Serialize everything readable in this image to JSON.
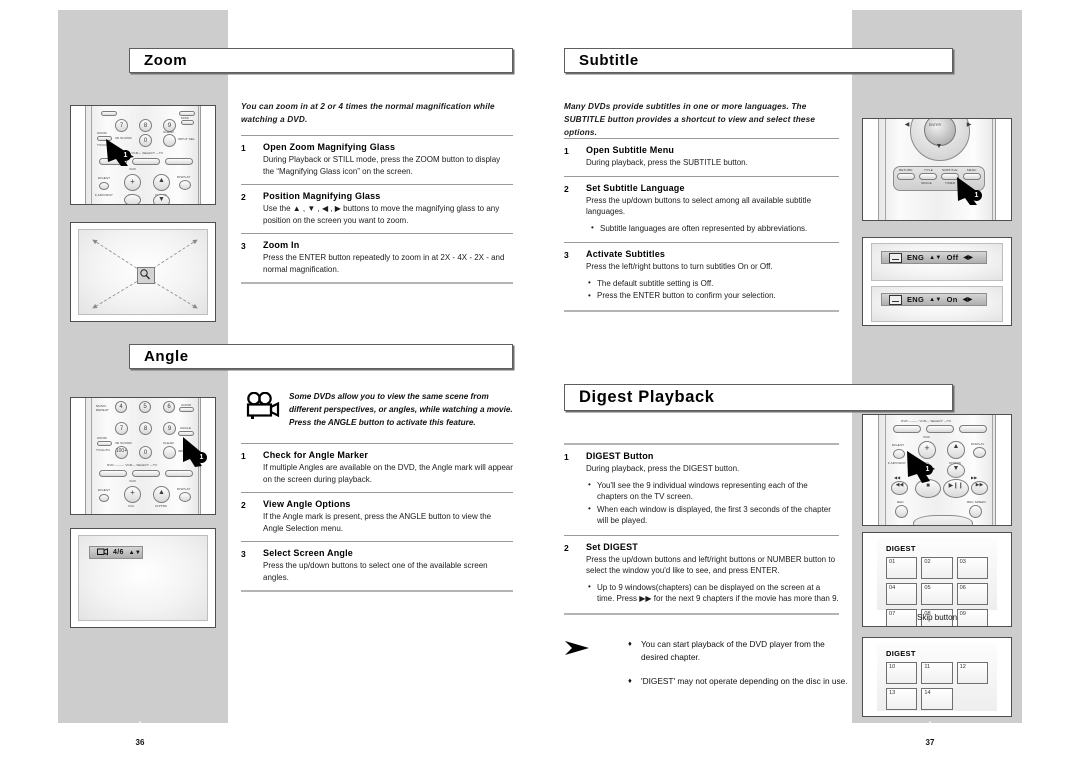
{
  "document": {
    "type": "dvd-player-user-manual-spread"
  },
  "left_page": {
    "page_number": "36",
    "sections": [
      {
        "id": "zoom",
        "heading": "Zoom",
        "intro": "You can zoom in at 2 or 4 times the normal magnification while watching a DVD.",
        "steps": [
          {
            "num": "1",
            "title": "Open Zoom Magnifying Glass",
            "desc": "During Playback or STILL mode, press the ZOOM button to display the “Magnifying Glass icon” on the screen.",
            "bullets": []
          },
          {
            "num": "2",
            "title": "Position Magnifying Glass",
            "desc": "Use the ▲ , ▼ , ◀ , ▶ buttons to move the magnifying glass to any position on the screen you want to zoom.",
            "bullets": []
          },
          {
            "num": "3",
            "title": "Zoom In",
            "desc": "Press the ENTER button repeatedly to zoom in at 2X - 4X - 2X - and normal magnification.",
            "bullets": []
          }
        ],
        "illustrations": {
          "remote_callout": "1",
          "remote_highlighted_button": "ZOOM",
          "screen_content": "magnifying-glass-with-four-diagonal-arrows"
        }
      },
      {
        "id": "angle",
        "heading": "Angle",
        "camera_note": "Some DVDs allow you to view the same scene from different perspectives, or angles, while watching a movie. Press the ANGLE button to activate this feature.",
        "steps": [
          {
            "num": "1",
            "title": "Check for Angle Marker",
            "desc": "If multiple Angles are available on the DVD, the Angle mark will appear on the screen during playback.",
            "bullets": []
          },
          {
            "num": "2",
            "title": "View Angle Options",
            "desc": "If the Angle mark is present, press the ANGLE button to view the Angle Selection menu.",
            "bullets": []
          },
          {
            "num": "3",
            "title": "Select Screen Angle",
            "desc": "Press the up/down buttons to select one of the available screen angles.",
            "bullets": []
          }
        ],
        "illustrations": {
          "remote_callout": "1",
          "remote_highlighted_button": "ANGLE",
          "osd_text": "4/6"
        }
      }
    ]
  },
  "right_page": {
    "page_number": "37",
    "sections": [
      {
        "id": "subtitle",
        "heading": "Subtitle",
        "intro": "Many DVDs provide subtitles in one or more languages. The SUBTITLE button provides a shortcut to view and select these options.",
        "steps": [
          {
            "num": "1",
            "title": "Open Subtitle Menu",
            "desc": "During playback, press the SUBTITLE button.",
            "bullets": []
          },
          {
            "num": "2",
            "title": "Set Subtitle Language",
            "desc": "Press the up/down buttons to select among all available subtitle languages.",
            "bullets": [
              "Subtitle languages are often represented by abbreviations."
            ]
          },
          {
            "num": "3",
            "title": "Activate Subtitles",
            "desc": "Press the left/right buttons to turn subtitles On or Off.",
            "bullets": [
              "The default subtitle setting is Off.",
              "Press the ENTER button to confirm your selection."
            ]
          }
        ],
        "illustrations": {
          "remote_callout": "1",
          "remote_highlighted_button": "SUBTITLE",
          "osd_bars": [
            {
              "lang": "ENG",
              "state": "Off"
            },
            {
              "lang": "ENG",
              "state": "On"
            }
          ]
        }
      },
      {
        "id": "digest-playback",
        "heading": "Digest Playback",
        "steps": [
          {
            "num": "1",
            "title": "DIGEST Button",
            "desc": "During playback, press the DIGEST button.",
            "bullets": [
              "You'll see the 9 individual windows representing each of the chapters on the TV screen.",
              "When each window is displayed, the first 3 seconds of the chapter will be played."
            ]
          },
          {
            "num": "2",
            "title": "Set DIGEST",
            "desc": "Press the up/down buttons and left/right buttons or NUMBER button to select the window you'd like to see, and press ENTER.",
            "bullets": [
              "Up to 9 windows(chapters) can be displayed on the screen at a time. Press ▶▶ for the next 9 chapters if the movie has more than 9."
            ]
          }
        ],
        "notes": [
          "You can start playback of the DVD player from the desired chapter.",
          "'DIGEST' may not operate depending on the disc in use."
        ],
        "illustrations": {
          "remote_callout": "1",
          "remote_highlighted_button": "DIGEST",
          "digest_screen_1": {
            "title": "DIGEST",
            "cells": [
              "01",
              "02",
              "03",
              "04",
              "05",
              "06",
              "07",
              "08",
              "09"
            ],
            "caption": "Skip button"
          },
          "digest_screen_2": {
            "title": "DIGEST",
            "cells": [
              "10",
              "11",
              "12",
              "13",
              "14"
            ]
          }
        }
      }
    ]
  },
  "remote_labels": {
    "zoom_remote": {
      "keys": [
        "7",
        "8",
        "9",
        "0"
      ],
      "small": [
        "ZOOM",
        "TV/VCR",
        "3D SOUND",
        "CLEAR",
        "MISC",
        "INPUT SEL.",
        "DVD",
        "VCR",
        "SELECT",
        "TV",
        "DIGEST",
        "F.ADV/SKIP",
        "VOL",
        "CH/TRK",
        "DISPLAY"
      ]
    },
    "angle_remote": {
      "keys": [
        "7",
        "8",
        "9",
        "0",
        "100+"
      ],
      "small": [
        "MUSIC REPEAT",
        "ANGLE",
        "CLEAR",
        "AUDIO",
        "ZOOM",
        "TV/AUTO",
        "3D SOUND",
        "INPUT SEL.",
        "DVD",
        "VCR",
        "SELECT",
        "TV",
        "DIGEST",
        "VOL",
        "CH/TRK",
        "DISPLAY"
      ]
    },
    "subtitle_remote": {
      "small": [
        "RETURN",
        "TITLE",
        "SUBTITLE",
        "MENU",
        "ENTER"
      ]
    },
    "digest_remote": {
      "small": [
        "DVD",
        "VCR",
        "SELECT",
        "TV",
        "DIGEST",
        "F.ADV/SKIP",
        "VOL",
        "CH/TRK",
        "DISPLAY",
        "REC",
        "REC SPEED"
      ]
    }
  },
  "colors": {
    "band_grey": "#cdcdcd",
    "rule_grey": "#9a9a9a",
    "heading_border": "#5e5e5e",
    "osd_bar": "#c2c2c2"
  }
}
